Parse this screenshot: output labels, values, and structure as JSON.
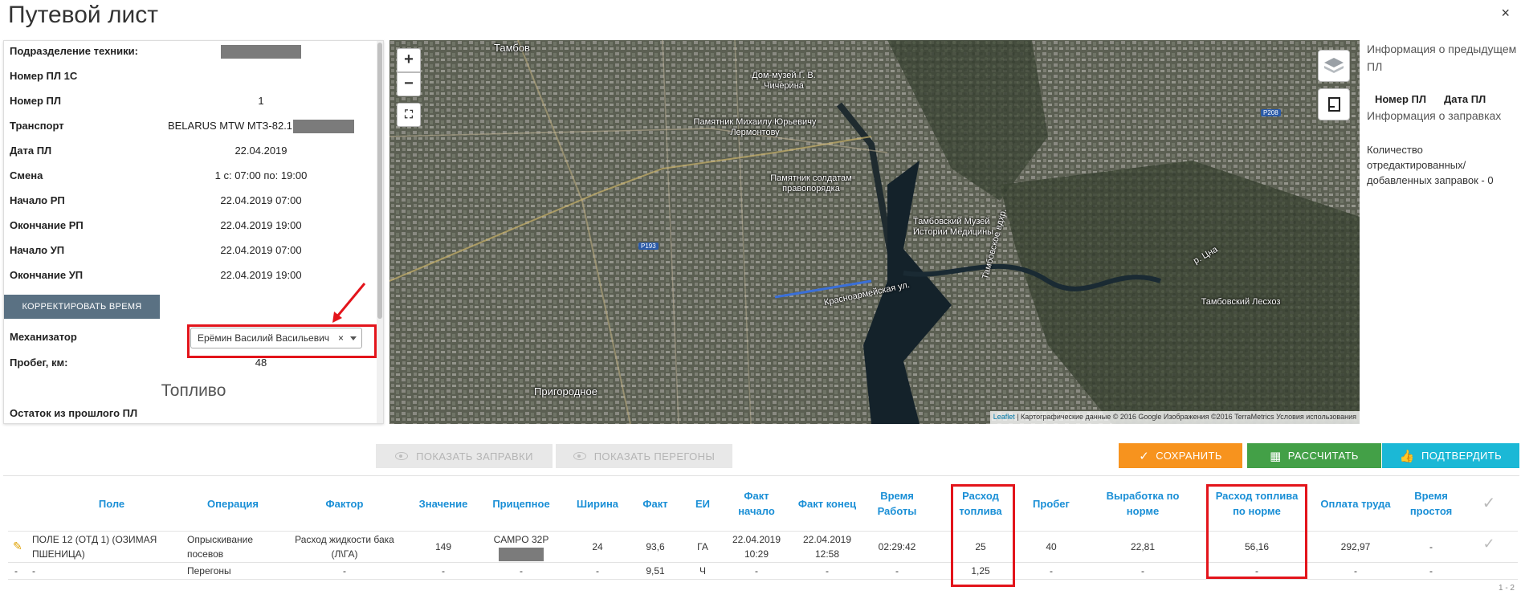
{
  "window": {
    "title": "Путевой лист",
    "close_glyph": "×"
  },
  "info": {
    "subdivision_label": "Подразделение техники:",
    "pl1c_label": "Номер ПЛ 1С",
    "pl_number_label": "Номер ПЛ",
    "pl_number": "1",
    "transport_label": "Транспорт",
    "transport": "BELARUS MTW МТЗ-82.1",
    "date_label": "Дата ПЛ",
    "date": "22.04.2019",
    "shift_label": "Смена",
    "shift": "1 с: 07:00 по: 19:00",
    "rp_start_label": "Начало РП",
    "rp_start": "22.04.2019 07:00",
    "rp_end_label": "Окончание РП",
    "rp_end": "22.04.2019 19:00",
    "up_start_label": "Начало УП",
    "up_start": "22.04.2019 07:00",
    "up_end_label": "Окончание УП",
    "up_end": "22.04.2019 19:00",
    "correct_time_button": "КОРРЕКТИРОВАТЬ ВРЕМЯ",
    "mechanic_label": "Механизатор",
    "mechanic_value": "Ерёмин Василий Васильевич",
    "mechanic_clear": "×",
    "mileage_label": "Пробег, км:",
    "mileage": "48",
    "fuel_title": "Топливо",
    "fuel_remain_label": "Остаток из прошлого ПЛ"
  },
  "map": {
    "zoom_in": "+",
    "zoom_out": "−",
    "fullscreen": "⛶",
    "labels": [
      "Тамбов",
      "Дом-музей Г. В. Чичерина",
      "Памятник Михаилу Юрьевичу Лермонтову",
      "Памятник солдатам правопорядка",
      "Тамбовский Музей Истории Медицины",
      "Тамбовское вдхр.",
      "Тамбовский Лесхоз",
      "Пригородное",
      "Красноармейская ул.",
      "р. Цна"
    ],
    "road_badges": [
      "P193",
      "P208"
    ],
    "attribution_link": "Leaflet",
    "attribution_text": " | Картографические данные © 2016 Google Изображения ©2016 TerraMetrics Условия использования"
  },
  "right_info": {
    "prev_title": "Информация о предыдущем ПЛ",
    "col_number": "Номер ПЛ",
    "col_date": "Дата ПЛ",
    "refuel_title": "Информация о заправках",
    "refuel_count": "Количество отредактированных/ добавленных заправок - 0"
  },
  "actions": {
    "show_refuels": "ПОКАЗАТЬ ЗАПРАВКИ",
    "show_runs": "ПОКАЗАТЬ ПЕРЕГОНЫ",
    "save": "СОХРАНИТЬ",
    "calculate": "РАССЧИТАТЬ",
    "confirm": "ПОДТВЕРДИТЬ"
  },
  "table": {
    "headers": {
      "field": "Поле",
      "operation": "Операция",
      "factor": "Фактор",
      "value": "Значение",
      "trailer": "Прицепное",
      "width": "Ширина",
      "fact": "Факт",
      "unit": "ЕИ",
      "fact_start": "Факт начало",
      "fact_end": "Факт конец",
      "work_time": "Время Работы",
      "fuel": "Расход топлива",
      "mileage": "Пробег",
      "norm_output": "Выработка по норме",
      "norm_fuel": "Расход топлива по норме",
      "pay": "Оплата труда",
      "idle": "Время простоя"
    },
    "row1": {
      "field": "ПОЛЕ 12 (ОТД 1) (ОЗИМАЯ ПШЕНИЦА)",
      "operation": "Опрыскивание посевов",
      "factor": "Расход жидкости бака (Л\\ГА)",
      "value": "149",
      "trailer": "CAMPO 32P",
      "width": "24",
      "fact": "93,6",
      "unit": "ГА",
      "fact_start": "22.04.2019 10:29",
      "fact_end": "22.04.2019 12:58",
      "work_time": "02:29:42",
      "fuel": "25",
      "mileage": "40",
      "norm_output": "22,81",
      "norm_fuel": "56,16",
      "pay": "292,97",
      "idle": "-"
    },
    "row2": {
      "c1": "-",
      "c2": "-",
      "operation": "Перегоны",
      "factor": "-",
      "value": "-",
      "trailer": "-",
      "width": "-",
      "fact": "9,51",
      "unit": "Ч",
      "fact_start": "-",
      "fact_end": "-",
      "work_time": "-",
      "fuel": "1,25",
      "mileage": "-",
      "norm_output": "-",
      "norm_fuel": "-",
      "pay": "-",
      "idle": "-"
    },
    "pager": "1 - 2"
  },
  "colors": {
    "highlight": "#e3141b",
    "header_text": "#1a8fd6",
    "save": "#f7931e",
    "calculate": "#43a047",
    "confirm": "#1bb8d6",
    "correct_button": "#5a7183"
  }
}
